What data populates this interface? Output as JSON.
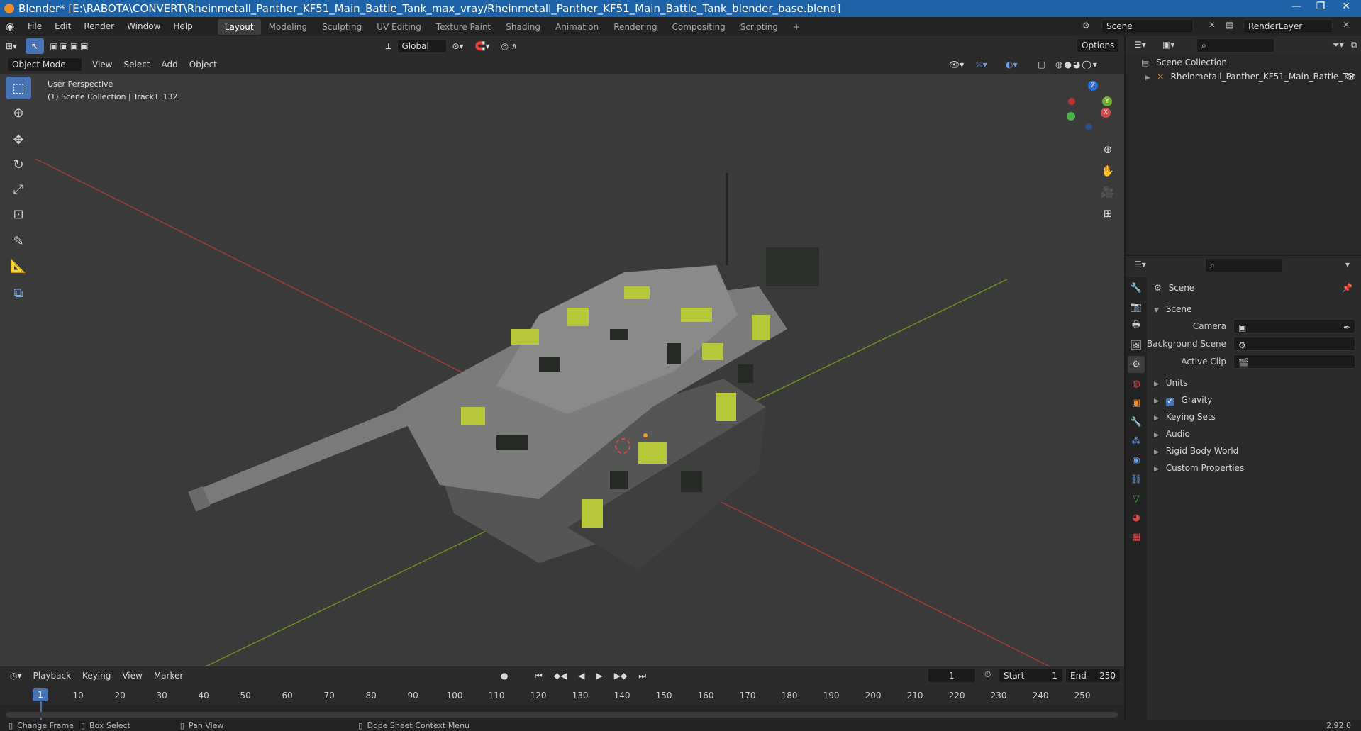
{
  "title_bar": {
    "title": "Blender* [E:\\RABOTA\\CONVERT\\Rheinmetall_Panther_KF51_Main_Battle_Tank_max_vray/Rheinmetall_Panther_KF51_Main_Battle_Tank_blender_base.blend]",
    "min": "—",
    "max": "❐",
    "close": "✕"
  },
  "menubar": {
    "items": [
      "File",
      "Edit",
      "Render",
      "Window",
      "Help"
    ],
    "workspaces": [
      "Layout",
      "Modeling",
      "Sculpting",
      "UV Editing",
      "Texture Paint",
      "Shading",
      "Animation",
      "Rendering",
      "Compositing",
      "Scripting"
    ],
    "add_workspace": "+",
    "scene": "Scene",
    "view_layer": "RenderLayer"
  },
  "viewport_header": {
    "transform_orientation": "Global",
    "options": "Options"
  },
  "viewport_sub": {
    "mode": "Object Mode",
    "menus": [
      "View",
      "Select",
      "Add",
      "Object"
    ]
  },
  "viewport": {
    "view_name": "User Perspective",
    "collection_info": "(1) Scene Collection | Track1_132",
    "gizmo": {
      "z": "Z",
      "y": "Y",
      "x": "X"
    }
  },
  "timeline_header": {
    "menus": [
      "Playback",
      "Keying",
      "View",
      "Marker"
    ],
    "current_frame": "1",
    "start_label": "Start",
    "start": "1",
    "end_label": "End",
    "end": "250"
  },
  "timeline": {
    "current": "1",
    "ticks": [
      "10",
      "20",
      "30",
      "40",
      "50",
      "60",
      "70",
      "80",
      "90",
      "100",
      "110",
      "120",
      "130",
      "140",
      "150",
      "160",
      "170",
      "180",
      "190",
      "200",
      "210",
      "220",
      "230",
      "240",
      "250"
    ]
  },
  "statusbar": {
    "items": [
      "Change Frame",
      "Box Select",
      "Pan View",
      "Dope Sheet Context Menu"
    ],
    "version": "2.92.0"
  },
  "outliner": {
    "root": "Scene Collection",
    "child": "Rheinmetall_Panther_KF51_Main_Battle_Tar"
  },
  "properties": {
    "context": "Scene",
    "section": "Scene",
    "camera_label": "Camera",
    "background_label": "Background Scene",
    "clip_label": "Active Clip",
    "panels": [
      "Units",
      "Gravity",
      "Keying Sets",
      "Audio",
      "Rigid Body World",
      "Custom Properties"
    ]
  },
  "colors": {
    "accent": "#4772b3",
    "titlebar": "#1e63a8",
    "camo_green": "#b6c83a",
    "camo_grey": "#7b7b7b",
    "camo_dark": "#262a24"
  }
}
